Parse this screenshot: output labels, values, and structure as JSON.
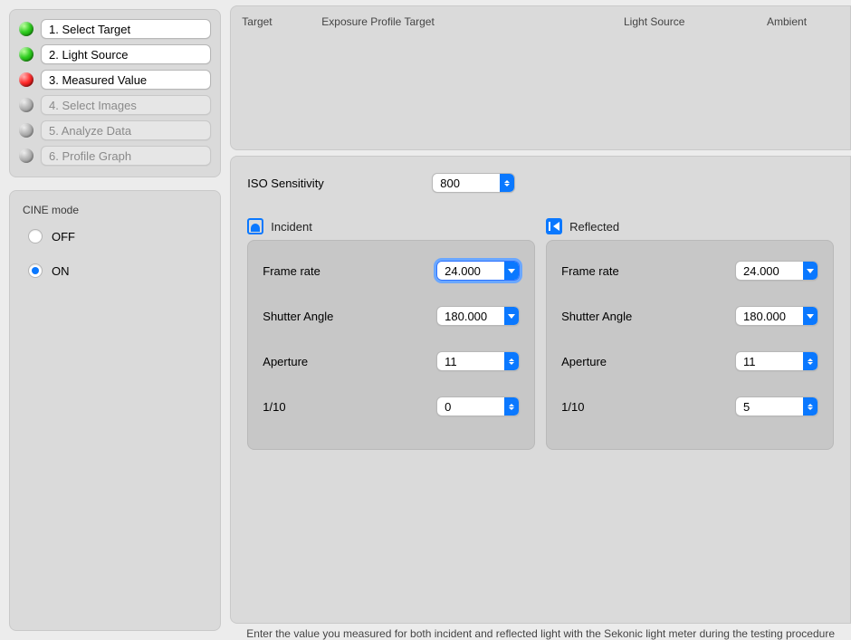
{
  "sidebar": {
    "steps": [
      {
        "label": "1. Select Target",
        "status": "green",
        "enabled": true
      },
      {
        "label": "2. Light Source",
        "status": "green",
        "enabled": true
      },
      {
        "label": "3. Measured Value",
        "status": "red",
        "enabled": true
      },
      {
        "label": "4. Select Images",
        "status": "grey",
        "enabled": false
      },
      {
        "label": "5. Analyze Data",
        "status": "grey",
        "enabled": false
      },
      {
        "label": "6. Profile Graph",
        "status": "grey",
        "enabled": false
      }
    ],
    "cine": {
      "title": "CINE mode",
      "off_label": "OFF",
      "on_label": "ON",
      "selected": "ON"
    }
  },
  "header": {
    "target_label": "Target",
    "exposure_profile_label": "Exposure Profile Target",
    "light_source_label": "Light Source",
    "ambient_label": "Ambient"
  },
  "settings": {
    "iso": {
      "label": "ISO Sensitivity",
      "value": "800"
    },
    "incident": {
      "title": "Incident",
      "frame_rate": {
        "label": "Frame rate",
        "value": "24.000",
        "focused": true
      },
      "shutter_angle": {
        "label": "Shutter Angle",
        "value": "180.000"
      },
      "aperture": {
        "label": "Aperture",
        "value": "11"
      },
      "tenth": {
        "label": "1/10",
        "value": "0"
      }
    },
    "reflected": {
      "title": "Reflected",
      "frame_rate": {
        "label": "Frame rate",
        "value": "24.000"
      },
      "shutter_angle": {
        "label": "Shutter Angle",
        "value": "180.000"
      },
      "aperture": {
        "label": "Aperture",
        "value": "11"
      },
      "tenth": {
        "label": "1/10",
        "value": "5"
      }
    }
  },
  "footer": {
    "text": "Enter the value you measured for both incident and reflected light with the Sekonic light meter during the testing procedure"
  }
}
